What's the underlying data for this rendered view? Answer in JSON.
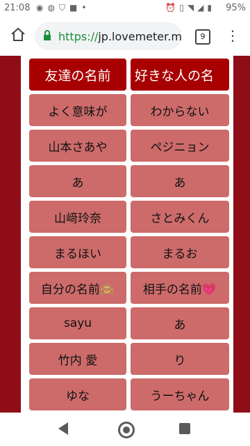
{
  "status_bar": {
    "time": "21:08",
    "battery": "95%",
    "left_icons": [
      "line-icon",
      "messenger-icon",
      "shield-icon",
      "app-icon",
      "dot-icon"
    ],
    "right_icons": [
      "alarm-icon",
      "vibrate-icon",
      "wifi-icon",
      "signal-icon",
      "battery-icon"
    ]
  },
  "browser": {
    "url_scheme": "https://",
    "url_host": "jp.lovemeter.me/",
    "tab_count": "9"
  },
  "table": {
    "header": {
      "left": "友達の名前",
      "right": "好きな人の名"
    },
    "rows": [
      {
        "left": "よく意味が",
        "right": "わからない"
      },
      {
        "left": "山本さあや",
        "right": "ペジニョン"
      },
      {
        "left": "あ",
        "right": "あ"
      },
      {
        "left": "山﨑玲奈",
        "right": "さとみくん"
      },
      {
        "left": "まるほい",
        "right": "まるお"
      },
      {
        "left": "自分の名前🙈",
        "right": "相手の名前💗"
      },
      {
        "left": "sayu",
        "right": "あ"
      },
      {
        "left": "竹内 愛",
        "right": "り"
      },
      {
        "left": "ゆな",
        "right": "うーちゃん"
      }
    ]
  },
  "colors": {
    "page_background": "#8f0d16",
    "header_cell": "#a80000",
    "body_cell": "#cd6b6b",
    "url_green": "#1a8e3c"
  }
}
